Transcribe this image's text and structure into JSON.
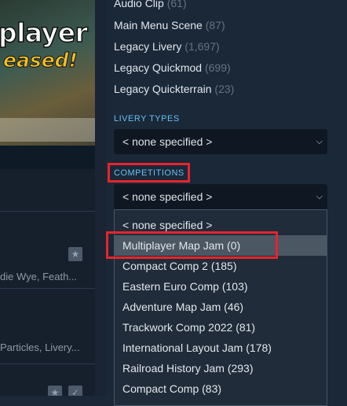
{
  "colors": {
    "accent": "#66c0f4",
    "highlight": "#e5252d",
    "background": "#1b2838"
  },
  "banner": {
    "line1": "player",
    "line2": "eased!"
  },
  "left_panel": {
    "item1_tags": "die Wye, Feath...",
    "item2_tags": "Particles, Livery..."
  },
  "top_list": [
    {
      "name": "Audio Clip",
      "count": "(61)"
    },
    {
      "name": "Main Menu Scene",
      "count": "(87)"
    },
    {
      "name": "Legacy Livery",
      "count": "(1,697)"
    },
    {
      "name": "Legacy Quickmod",
      "count": "(699)"
    },
    {
      "name": "Legacy Quickterrain",
      "count": "(23)"
    }
  ],
  "livery_types": {
    "label": "LIVERY TYPES",
    "value": "< none specified >"
  },
  "competitions": {
    "label": "COMPETITIONS",
    "value": "< none specified >",
    "options": [
      "< none specified >",
      "Multiplayer Map Jam (0)",
      "Compact Comp 2 (185)",
      "Eastern Euro Comp (103)",
      "Adventure Map Jam (46)",
      "Trackwork Comp 2022 (81)",
      "International Layout Jam (178)",
      "Railroad History Jam (293)",
      "Compact Comp (83)"
    ],
    "hovered_index": 1
  },
  "icons": {
    "star": "star-icon",
    "chevron": "chevron-down-icon",
    "check": "check-icon"
  }
}
